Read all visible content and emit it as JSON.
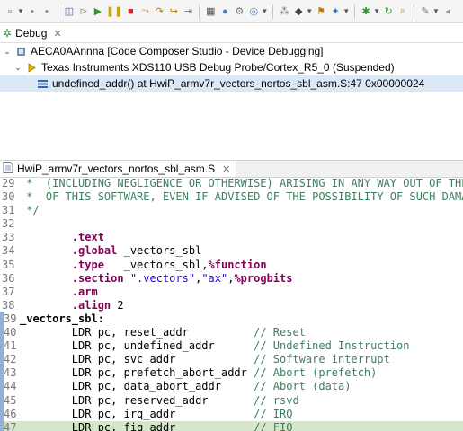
{
  "toolbar": {
    "buttons": [
      "new",
      "save",
      "save-all",
      "skip-breakpoints",
      "terminate-all",
      "resume",
      "suspend",
      "terminate",
      "disconnect",
      "step-into",
      "step-over",
      "step-return",
      "memory-browser",
      "breakpoint",
      "target-config",
      "expressions",
      "debug",
      "run",
      "external-tools",
      "debug-config",
      "step-filters",
      "refresh",
      "search",
      "navigate-back",
      "navigate-forward"
    ]
  },
  "debug_view": {
    "tab_label": "Debug",
    "tree": [
      {
        "label": "AECA0AAnnna [Code Composer Studio - Device Debugging]",
        "expanded": true
      },
      {
        "label": "Texas Instruments XDS110 USB Debug Probe/Cortex_R5_0 (Suspended)",
        "expanded": true
      },
      {
        "label": "undefined_addr() at HwiP_armv7r_vectors_nortos_sbl_asm.S:47 0x00000024",
        "selected": true
      }
    ]
  },
  "editor": {
    "tab_label": "HwiP_armv7r_vectors_nortos_sbl_asm.S",
    "lines": [
      {
        "n": "29",
        "code": " *  (INCLUDING NEGLIGENCE OR OTHERWISE) ARISING IN ANY WAY OUT OF THE USE"
      },
      {
        "n": "30",
        "code": " *  OF THIS SOFTWARE, EVEN IF ADVISED OF THE POSSIBILITY OF SUCH DAMAGE."
      },
      {
        "n": "31",
        "code": " */"
      },
      {
        "n": "32",
        "code": ""
      },
      {
        "n": "33",
        "code": "        .text"
      },
      {
        "n": "34",
        "code": "        .global _vectors_sbl"
      },
      {
        "n": "35",
        "code": "        .type   _vectors_sbl,%function"
      },
      {
        "n": "36",
        "code": "        .section \".vectors\",\"ax\",%progbits"
      },
      {
        "n": "37",
        "code": "        .arm"
      },
      {
        "n": "38",
        "code": "        .align 2"
      },
      {
        "n": "39",
        "code": "_vectors_sbl:"
      },
      {
        "n": "40",
        "code": "        LDR pc, reset_addr          // Reset"
      },
      {
        "n": "41",
        "code": "        LDR pc, undefined_addr      // Undefined Instruction"
      },
      {
        "n": "42",
        "code": "        LDR pc, svc_addr            // Software interrupt"
      },
      {
        "n": "43",
        "code": "        LDR pc, prefetch_abort_addr // Abort (prefetch)"
      },
      {
        "n": "44",
        "code": "        LDR pc, data_abort_addr     // Abort (data)"
      },
      {
        "n": "45",
        "code": "        LDR pc, reserved_addr       // rsvd"
      },
      {
        "n": "46",
        "code": "        LDR pc, irq_addr            // IRQ"
      },
      {
        "n": "47",
        "code": "        LDR pc, fiq_addr            // FIQ"
      }
    ],
    "current_line": "47"
  }
}
